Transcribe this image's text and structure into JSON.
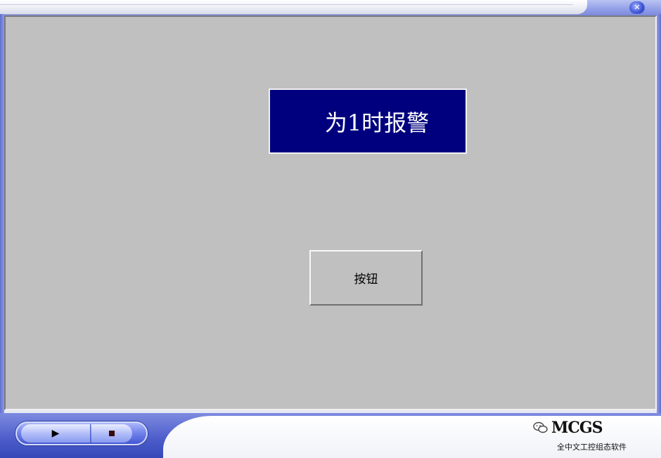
{
  "window": {
    "close_glyph": "✕"
  },
  "canvas": {
    "alarm_text": "为1时报警",
    "button_label": "按钮",
    "alarm_bg_color": "#00007e",
    "canvas_bg_color": "#c0c0c0"
  },
  "player": {
    "play_glyph": "▶",
    "stop_icon": "stop-icon"
  },
  "branding": {
    "logo_text": "MCGS",
    "subtitle": "全中文工控组态软件",
    "wechat_icon": "wechat-icon"
  }
}
